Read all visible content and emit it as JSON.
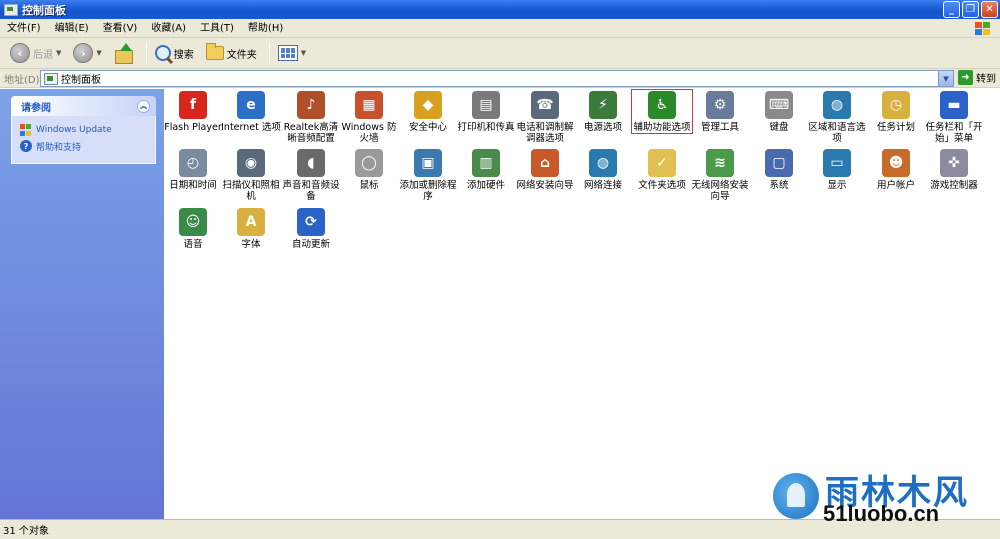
{
  "window": {
    "title": "控制面板"
  },
  "menu": [
    "文件(F)",
    "编辑(E)",
    "查看(V)",
    "收藏(A)",
    "工具(T)",
    "帮助(H)"
  ],
  "toolbar": {
    "back": "后退",
    "search": "搜索",
    "folders": "文件夹"
  },
  "address": {
    "label": "地址(D)",
    "value": "控制面板",
    "go": "转到"
  },
  "task_pane": {
    "title": "请参阅",
    "links": [
      "Windows Update",
      "帮助和支持"
    ]
  },
  "items": [
    {
      "label": "Flash Player",
      "icon": "flash-icon",
      "color": "#d8261c",
      "glyph": "f"
    },
    {
      "label": "Internet 选项",
      "icon": "globe-icon",
      "color": "#2b6fc7",
      "glyph": "e"
    },
    {
      "label": "Realtek高清晰音频配置",
      "icon": "speaker-icon",
      "color": "#b0502a",
      "glyph": "♪"
    },
    {
      "label": "Windows 防火墙",
      "icon": "firewall-icon",
      "color": "#c8502a",
      "glyph": "▦"
    },
    {
      "label": "安全中心",
      "icon": "shield-icon",
      "color": "#d8a020",
      "glyph": "◆"
    },
    {
      "label": "打印机和传真",
      "icon": "printer-icon",
      "color": "#7a7a7a",
      "glyph": "▤"
    },
    {
      "label": "电话和调制解调器选项",
      "icon": "phone-icon",
      "color": "#5a6a7a",
      "glyph": "☎"
    },
    {
      "label": "电源选项",
      "icon": "power-icon",
      "color": "#3a7a3a",
      "glyph": "⚡"
    },
    {
      "label": "辅助功能选项",
      "icon": "accessibility-icon",
      "color": "#2a8a2a",
      "glyph": "♿"
    },
    {
      "label": "管理工具",
      "icon": "admin-tools-icon",
      "color": "#6a7a9a",
      "glyph": "⚙"
    },
    {
      "label": "键盘",
      "icon": "keyboard-icon",
      "color": "#8a8a8a",
      "glyph": "⌨"
    },
    {
      "label": "区域和语言选项",
      "icon": "region-globe-icon",
      "color": "#2a7ab0",
      "glyph": "◍"
    },
    {
      "label": "任务计划",
      "icon": "scheduled-tasks-icon",
      "color": "#d8b040",
      "glyph": "◷"
    },
    {
      "label": "任务栏和「开始」菜单",
      "icon": "taskbar-icon",
      "color": "#2a62c8",
      "glyph": "▬"
    },
    {
      "label": "日期和时间",
      "icon": "clock-icon",
      "color": "#7a8aa0",
      "glyph": "◴"
    },
    {
      "label": "扫描仪和照相机",
      "icon": "scanner-icon",
      "color": "#5a6a7a",
      "glyph": "◉"
    },
    {
      "label": "声音和音频设备",
      "icon": "sound-icon",
      "color": "#6a6a6a",
      "glyph": "◖"
    },
    {
      "label": "鼠标",
      "icon": "mouse-icon",
      "color": "#9a9a9a",
      "glyph": "◯"
    },
    {
      "label": "添加或删除程序",
      "icon": "add-remove-icon",
      "color": "#3a7ab0",
      "glyph": "▣"
    },
    {
      "label": "添加硬件",
      "icon": "hardware-icon",
      "color": "#4a8a4a",
      "glyph": "▥"
    },
    {
      "label": "网络安装向导",
      "icon": "network-house-icon",
      "color": "#c85a2a",
      "glyph": "⌂"
    },
    {
      "label": "网络连接",
      "icon": "network-globe-icon",
      "color": "#2a7ab0",
      "glyph": "◍"
    },
    {
      "label": "文件夹选项",
      "icon": "folder-options-icon",
      "color": "#e0c050",
      "glyph": "✓"
    },
    {
      "label": "无线网络安装向导",
      "icon": "wireless-icon",
      "color": "#4a9a4a",
      "glyph": "≋"
    },
    {
      "label": "系统",
      "icon": "system-icon",
      "color": "#4a6ab0",
      "glyph": "▢"
    },
    {
      "label": "显示",
      "icon": "display-icon",
      "color": "#2a7ab0",
      "glyph": "▭"
    },
    {
      "label": "用户帐户",
      "icon": "user-accounts-icon",
      "color": "#c86a2a",
      "glyph": "☻"
    },
    {
      "label": "游戏控制器",
      "icon": "game-controller-icon",
      "color": "#8a8aa0",
      "glyph": "✜"
    },
    {
      "label": "语音",
      "icon": "speech-icon",
      "color": "#3a8a4a",
      "glyph": "☺"
    },
    {
      "label": "字体",
      "icon": "fonts-icon",
      "color": "#d8b040",
      "glyph": "A"
    },
    {
      "label": "自动更新",
      "icon": "auto-update-icon",
      "color": "#2a62c8",
      "glyph": "⟳"
    }
  ],
  "status": {
    "text": "31 个对象"
  },
  "watermark": {
    "brand": "雨林木风",
    "url": "51luobo.cn"
  }
}
